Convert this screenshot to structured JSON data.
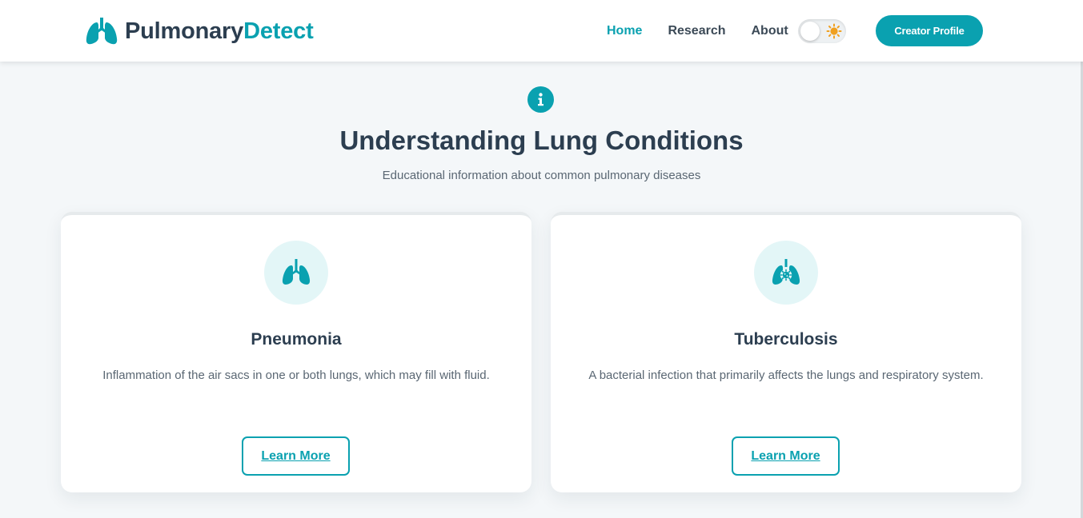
{
  "colors": {
    "accent": "#0aa1b0",
    "heading": "#2c3e50",
    "muted": "#5a6773",
    "background": "#f4f7f9",
    "icon_bg": "#e3f6f7",
    "sun": "#f0a020"
  },
  "brand": {
    "name_part1": "Pulmonary",
    "name_part2": "Detect",
    "icon": "lungs-icon"
  },
  "nav": {
    "items": [
      {
        "label": "Home",
        "active": true
      },
      {
        "label": "Research",
        "active": false
      },
      {
        "label": "About",
        "active": false
      }
    ],
    "theme_toggle": {
      "state": "light",
      "icon": "sun-icon"
    },
    "cta_label": "Creator Profile"
  },
  "section": {
    "badge_icon": "info-icon",
    "title": "Understanding Lung Conditions",
    "subtitle": "Educational information about common pulmonary diseases"
  },
  "cards": [
    {
      "icon": "lungs-icon",
      "title": "Pneumonia",
      "description": "Inflammation of the air sacs in one or both lungs, which may fill with fluid.",
      "button_label": "Learn More"
    },
    {
      "icon": "lungs-virus-icon",
      "title": "Tuberculosis",
      "description": "A bacterial infection that primarily affects the lungs and respiratory system.",
      "button_label": "Learn More"
    }
  ]
}
